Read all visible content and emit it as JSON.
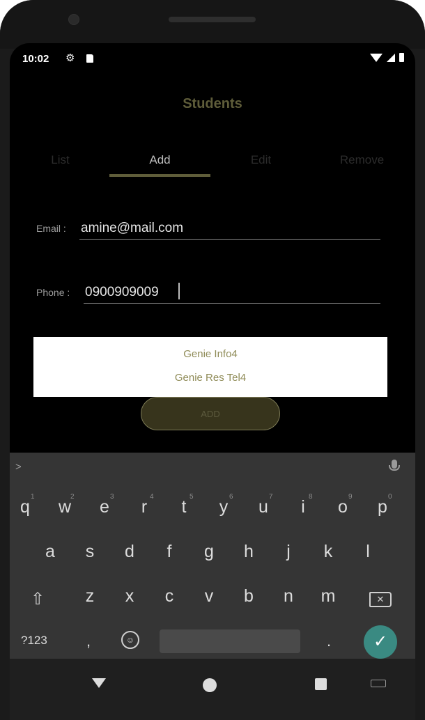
{
  "status_bar": {
    "time": "10:02",
    "gear_icon": "gear-icon",
    "sd_icon": "sd-card-icon",
    "wifi_icon": "wifi-icon",
    "signal_icon": "signal-icon",
    "battery_icon": "battery-icon"
  },
  "app": {
    "title": "Students"
  },
  "tabs": [
    {
      "label": "List",
      "active": false
    },
    {
      "label": "Add",
      "active": true
    },
    {
      "label": "Edit",
      "active": false
    },
    {
      "label": "Remove",
      "active": false
    }
  ],
  "form": {
    "email_label": "Email :",
    "email_value": "amine@mail.com",
    "phone_label": "Phone :",
    "phone_value": "0900909009"
  },
  "popup": {
    "items": [
      "Genie Info4",
      "Genie Res Tel4"
    ]
  },
  "add_button": {
    "label": "ADD"
  },
  "keyboard": {
    "row1": [
      "q",
      "w",
      "e",
      "r",
      "t",
      "y",
      "u",
      "i",
      "o",
      "p"
    ],
    "row1_hints": [
      "1",
      "2",
      "3",
      "4",
      "5",
      "6",
      "7",
      "8",
      "9",
      "0"
    ],
    "row2": [
      "a",
      "s",
      "d",
      "f",
      "g",
      "h",
      "j",
      "k",
      "l"
    ],
    "row3": [
      "z",
      "x",
      "c",
      "v",
      "b",
      "n",
      "m"
    ],
    "symbols_key": "?123",
    "comma_key": ",",
    "period_key": ".",
    "emoji_key": "☺",
    "enter_key": "✓",
    "shift_key": "⇧",
    "backspace_key": "✕",
    "chevron": ">"
  },
  "colors": {
    "accent": "#5f5d3a",
    "background": "#000000",
    "keyboard_bg": "#353535",
    "enter_key": "#3a8a82"
  }
}
